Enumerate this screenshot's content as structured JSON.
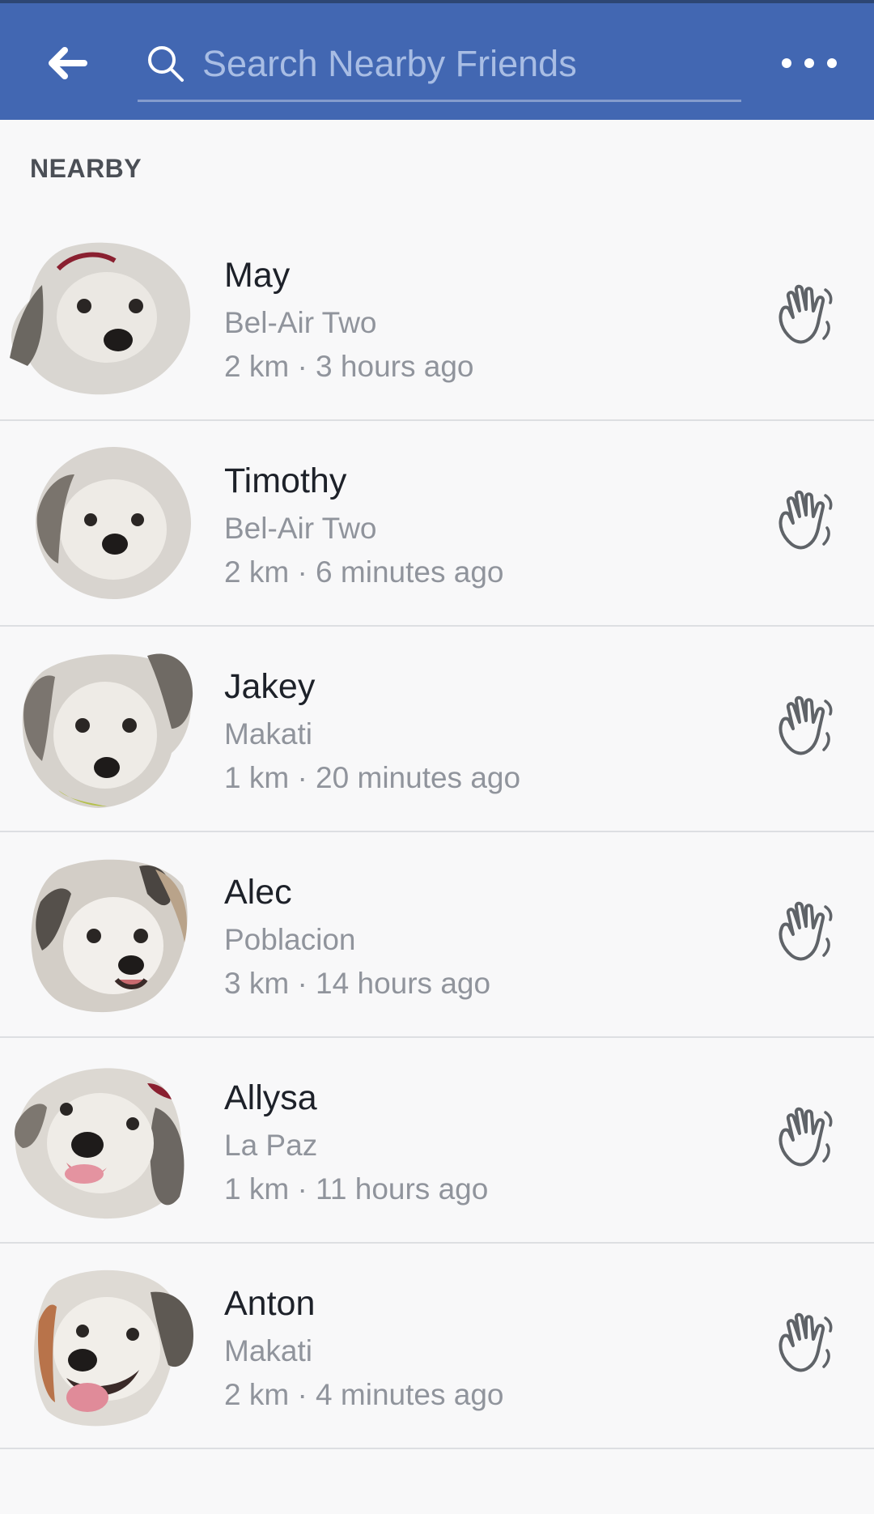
{
  "header": {
    "back_icon": "back-arrow-icon",
    "search_icon": "search-icon",
    "search_placeholder": "Search Nearby Friends",
    "search_value": "",
    "more_icon": "more-horizontal-icon",
    "background_color": "#4267b2"
  },
  "section": {
    "title": "NEARBY"
  },
  "friends": [
    {
      "name": "May",
      "location": "Bel-Air Two",
      "meta": "2 km · 3 hours ago",
      "wave_icon": "wave-hand-icon"
    },
    {
      "name": "Timothy",
      "location": "Bel-Air Two",
      "meta": "2 km · 6 minutes ago",
      "wave_icon": "wave-hand-icon"
    },
    {
      "name": "Jakey",
      "location": "Makati",
      "meta": "1 km · 20 minutes ago",
      "wave_icon": "wave-hand-icon"
    },
    {
      "name": "Alec",
      "location": "Poblacion",
      "meta": "3 km · 14 hours ago",
      "wave_icon": "wave-hand-icon"
    },
    {
      "name": "Allysa",
      "location": "La Paz",
      "meta": "1 km · 11 hours ago",
      "wave_icon": "wave-hand-icon"
    },
    {
      "name": "Anton",
      "location": "Makati",
      "meta": "2 km · 4 minutes ago",
      "wave_icon": "wave-hand-icon"
    }
  ]
}
